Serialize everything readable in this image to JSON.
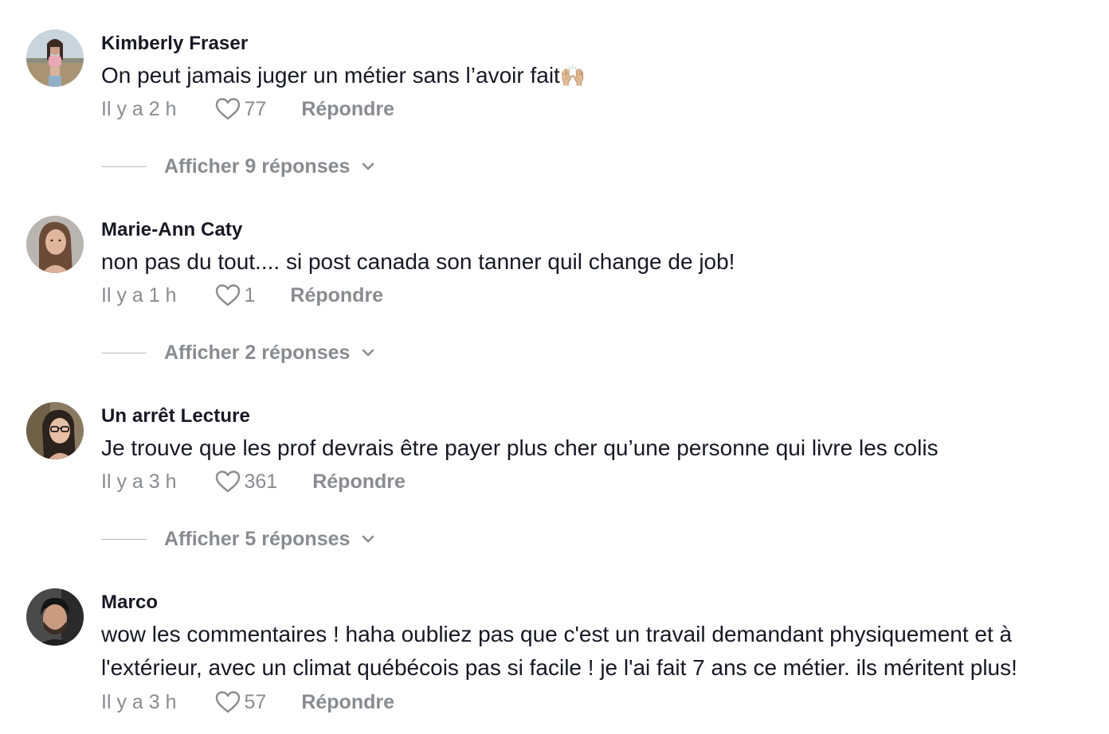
{
  "comments": [
    {
      "username": "Kimberly Fraser",
      "text": "On peut jamais juger un métier sans l’avoir fait",
      "emoji": "🙌🏼",
      "time": "Il y a 2 h",
      "likes": "77",
      "reply_label": "Répondre",
      "view_replies": "Afficher 9 réponses",
      "avatar_colors": [
        "#b7a78a",
        "#c8d3dc",
        "#e8a3b0"
      ]
    },
    {
      "username": "Marie-Ann Caty",
      "text": "non pas du tout.... si post canada son tanner quil change de job!",
      "time": "Il y a 1 h",
      "likes": "1",
      "reply_label": "Répondre",
      "view_replies": "Afficher 2 réponses",
      "avatar_colors": [
        "#a8a39e",
        "#d9b49a",
        "#6a4a3a"
      ]
    },
    {
      "username": "Un arrêt Lecture",
      "text": "Je trouve que les prof devrais être payer plus cher qu’une personne qui livre les colis",
      "time": "Il y a 3 h",
      "likes": "361",
      "reply_label": "Répondre",
      "view_replies": "Afficher 5 réponses",
      "avatar_colors": [
        "#7a6a52",
        "#e2bca0",
        "#2e2520"
      ]
    },
    {
      "username": "Marco",
      "text": "wow les commentaires ! haha oubliez pas que c'est un travail demandant physiquement et à l'extérieur, avec un climat québécois pas si facile ! je l'ai fait 7 ans ce métier. ils méritent plus!",
      "time": "Il y a 3 h",
      "likes": "57",
      "reply_label": "Répondre",
      "avatar_colors": [
        "#3a3a3a",
        "#c49a80",
        "#1c1c1c"
      ]
    }
  ]
}
